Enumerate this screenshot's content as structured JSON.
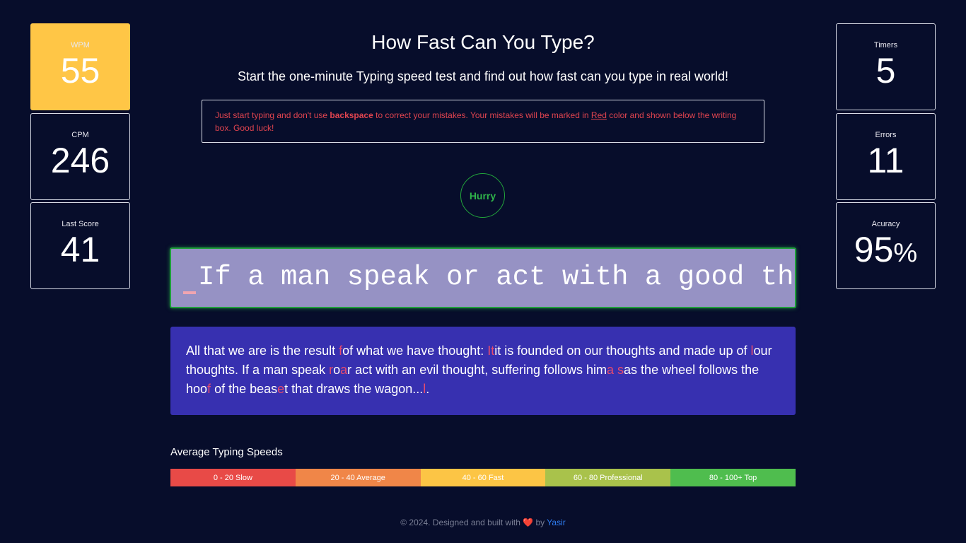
{
  "stats": {
    "wpm": {
      "label": "WPM",
      "value": "55"
    },
    "cpm": {
      "label": "CPM",
      "value": "246"
    },
    "last_score": {
      "label": "Last Score",
      "value": "41"
    },
    "timers": {
      "label": "Timers",
      "value": "5"
    },
    "errors": {
      "label": "Errors",
      "value": "11"
    },
    "accuracy": {
      "label": "Acuracy",
      "value": "95",
      "unit": "%"
    }
  },
  "header": {
    "title": "How Fast Can You Type?",
    "subtitle": "Start the one-minute Typing speed test and find out how fast can you type in real world!"
  },
  "instructions": {
    "part1": "Just start typing and don't use ",
    "bold": "backspace",
    "part2": " to correct your mistakes. Your mistakes will be marked in ",
    "underline": "Red",
    "part3": " color and shown below the writing box. Good luck!"
  },
  "status": {
    "hurry": "Hurry"
  },
  "typing": {
    "text": "If a man speak or act with a good thought, happiness follows"
  },
  "result": {
    "segments": [
      {
        "t": "All that we are is the result ",
        "err": false
      },
      {
        "t": "f",
        "err": true
      },
      {
        "t": "of what we have thought: ",
        "err": false
      },
      {
        "t": "It",
        "err": true
      },
      {
        "t": "it is founded on our thoughts and made up of ",
        "err": false
      },
      {
        "t": "l",
        "err": true
      },
      {
        "t": "our thoughts. If a man speak ",
        "err": false
      },
      {
        "t": "r",
        "err": true
      },
      {
        "t": "o",
        "err": false
      },
      {
        "t": "a",
        "err": true
      },
      {
        "t": "r act with an evil thought, suffering follows him",
        "err": false
      },
      {
        "t": "a",
        "err": true
      },
      {
        "t": " ",
        "err": false
      },
      {
        "t": "s",
        "err": true
      },
      {
        "t": "as the wheel follows the hoo",
        "err": false
      },
      {
        "t": "f",
        "err": true
      },
      {
        "t": " of the beas",
        "err": false
      },
      {
        "t": "e",
        "err": true
      },
      {
        "t": "t that draws the wagon...",
        "err": false
      },
      {
        "t": "l",
        "err": true
      },
      {
        "t": ".",
        "err": false
      }
    ]
  },
  "speeds": {
    "label": "Average Typing Speeds",
    "segments": [
      {
        "label": "0 - 20 Slow",
        "color": "#e84a47"
      },
      {
        "label": "20 - 40 Average",
        "color": "#f08648"
      },
      {
        "label": "40 - 60 Fast",
        "color": "#fcc545"
      },
      {
        "label": "60 - 80 Professional",
        "color": "#a9c24b"
      },
      {
        "label": "80 - 100+ Top",
        "color": "#4fbd4e"
      }
    ]
  },
  "footer": {
    "prefix": "© 2024. Designed and built with ",
    "heart": "❤️",
    "by": " by ",
    "author": "Yasir"
  }
}
